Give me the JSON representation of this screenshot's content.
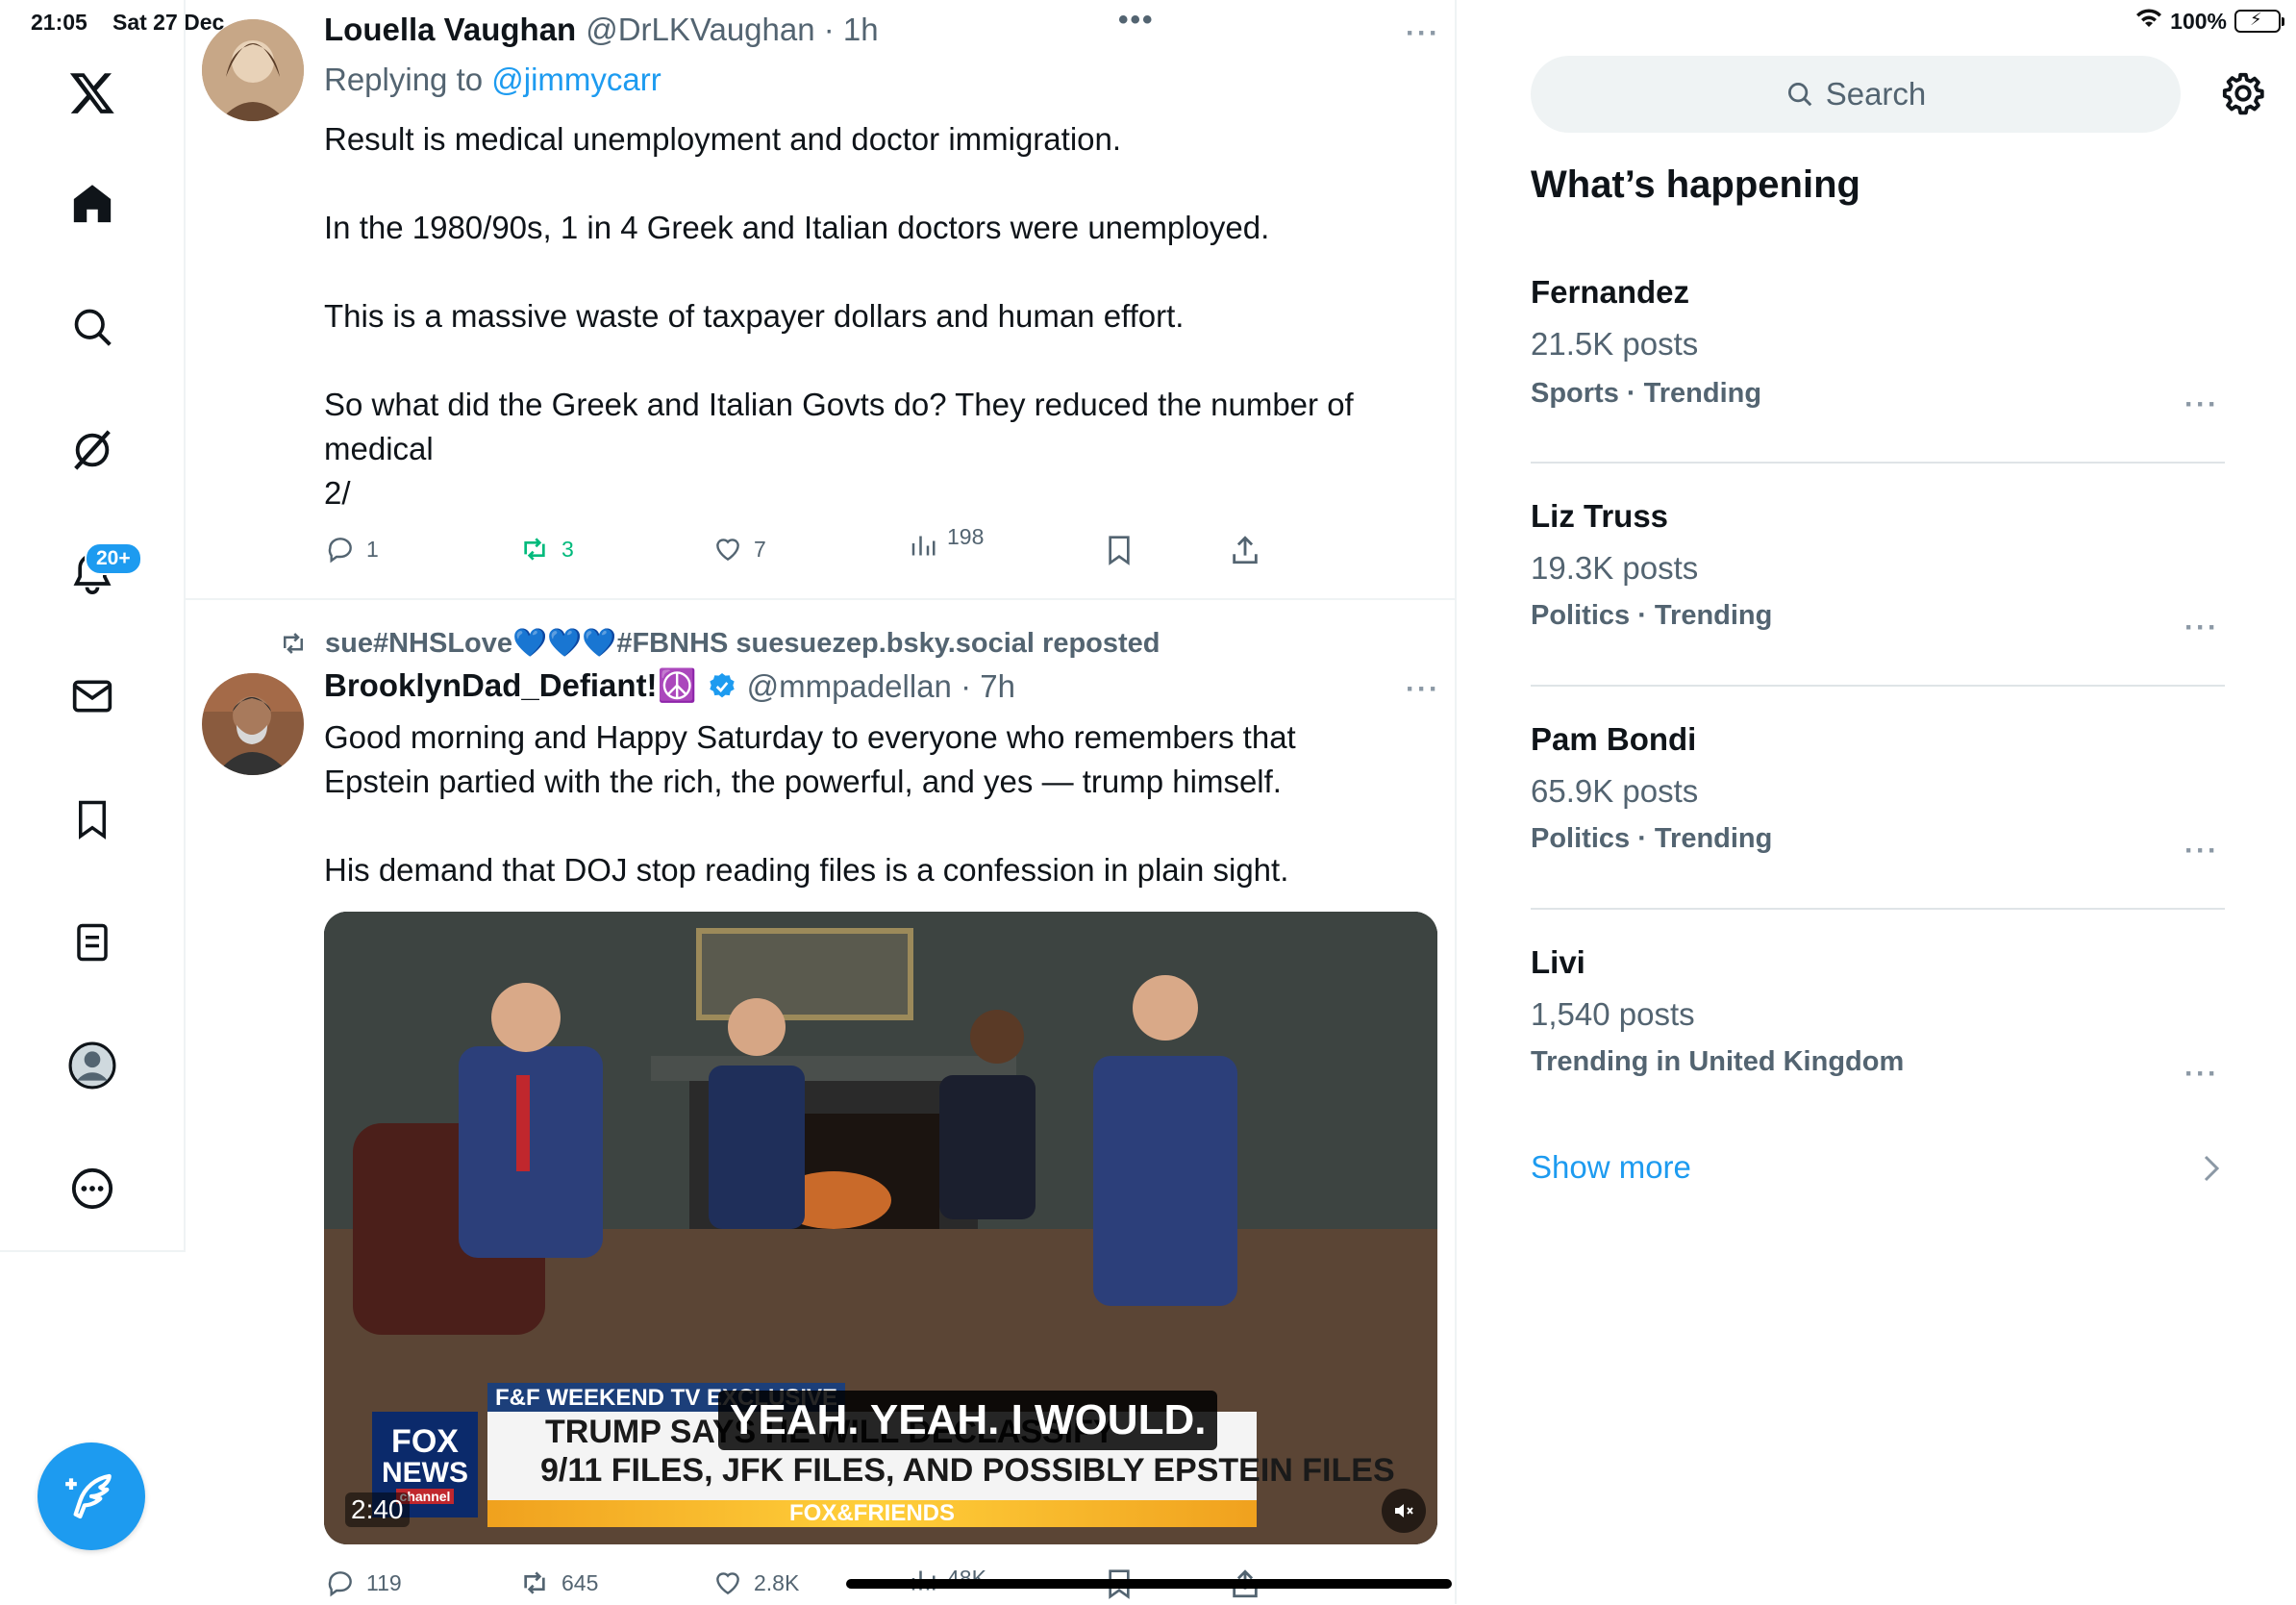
{
  "status_bar": {
    "time": "21:05",
    "date": "Sat 27 Dec",
    "battery": "100%"
  },
  "sidebar": {
    "notifications_badge": "20+",
    "items": [
      "home",
      "search",
      "grok",
      "notifications",
      "messages",
      "bookmarks",
      "lists",
      "profile",
      "more"
    ]
  },
  "feed": {
    "top_dots": "•••",
    "tweet1": {
      "name": "Louella Vaughan",
      "handle": "@DrLKVaughan · 1h",
      "replying_label": "Replying to ",
      "replying_handle": "@jimmycarr",
      "text": "Result is medical unemployment and doctor immigration.\n\nIn the 1980/90s, 1 in 4 Greek and Italian doctors were unemployed.\n\nThis is a massive waste of taxpayer dollars and human effort.\n\nSo what did the Greek and Italian Govts do? They reduced the number of\nmedical\n2/",
      "replies": "1",
      "reposts": "3",
      "likes": "7",
      "views": "198"
    },
    "tweet2": {
      "repost_label": "sue#NHSLove💙💙💙#FBNHS suesuezep.bsky.social reposted",
      "name": "BrooklynDad_Defiant!☮️",
      "handle": "@mmpadellan · 7h",
      "text": "Good morning and Happy Saturday to everyone who remembers that\nEpstein partied with the rich, the powerful, and yes — trump himself.\n\nHis demand that DOJ stop reading files is a confession in plain sight.",
      "video": {
        "duration": "2:40",
        "banner_tag": "F&F WEEKEND TV EXCLUSIVE",
        "headline_line1": "TRUMP SAYS HE WILL DECLASSIFY",
        "headline_line2": "9/11 FILES, JFK FILES, AND POSSIBLY EPSTEIN FILES",
        "caption": "YEAH. YEAH. I WOULD.",
        "network_line1": "FOX",
        "network_line2": "NEWS",
        "network_line3": "channel",
        "show": "FOX&FRIENDS"
      },
      "replies": "119",
      "reposts": "645",
      "likes": "2.8K",
      "views": "48K"
    }
  },
  "right": {
    "search_placeholder": "Search",
    "section_title": "What’s happening",
    "trends": [
      {
        "title": "Fernandez",
        "count": "21.5K posts",
        "category": "Sports · Trending"
      },
      {
        "title": "Liz Truss",
        "count": "19.3K posts",
        "category": "Politics · Trending"
      },
      {
        "title": "Pam Bondi",
        "count": "65.9K posts",
        "category": "Politics · Trending"
      },
      {
        "title": "Livi",
        "count": "1,540 posts",
        "category": "Trending in United Kingdom"
      }
    ],
    "show_more": "Show more"
  },
  "colors": {
    "accent": "#1d9bf0",
    "repost_green": "#00ba7c",
    "muted": "#536471"
  }
}
